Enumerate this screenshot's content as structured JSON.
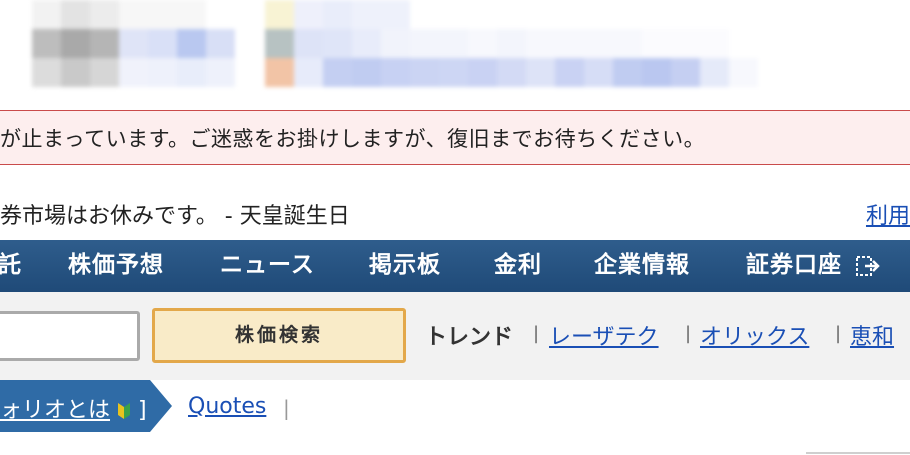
{
  "alert": {
    "message": "が止まっています。ご迷惑をお掛けしますが、復旧までお待ちください。"
  },
  "info": {
    "holiday_text": "券市場はお休みです。 - 天皇誕生日",
    "usage_link": "利用"
  },
  "nav": {
    "items": [
      "託",
      "株価予想",
      "ニュース",
      "掲示板",
      "金利",
      "企業情報",
      "証券口座"
    ],
    "exit_icon": "logout-icon"
  },
  "search": {
    "button_label": "株価検索",
    "input_value": ""
  },
  "trends": {
    "label": "トレンド",
    "links": [
      "レーザテク",
      "オリックス",
      "恵和"
    ]
  },
  "breadcrumb": {
    "portfolio_label": "ォリオとは",
    "portfolio_close": "]",
    "quotes": "Quotes"
  },
  "colors": {
    "nav_bg": "#24507f",
    "alert_bg": "#fdeeee",
    "alert_border": "#c94a4a",
    "link": "#1a4fb5",
    "search_button_bg": "#f9ebc8",
    "search_button_border": "#e3a84a"
  }
}
